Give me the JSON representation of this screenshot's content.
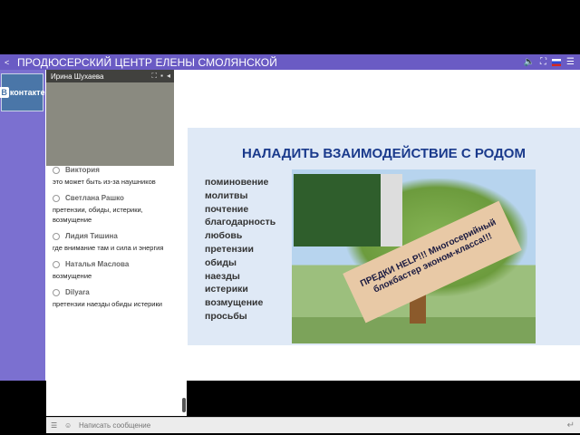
{
  "topbar": {
    "title": "ПРОДЮСЕРСКИЙ ЦЕНТР ЕЛЕНЫ СМОЛЯНСКОЙ",
    "icons": [
      "share-icon",
      "volume-icon",
      "fullscreen-icon",
      "flag-ru",
      "menu-icon"
    ]
  },
  "vk": {
    "label": "контакте",
    "b_label": "В"
  },
  "webcam": {
    "name": "Ирина Шухаева"
  },
  "chat": {
    "messages": [
      {
        "name": "Виктория",
        "text": "это может быть из-за наушников"
      },
      {
        "name": "Светлана Рашко",
        "text": "претензии, обиды, истерики, возмущение"
      },
      {
        "name": "Лидия Тишина",
        "text": "где внимание там и сила и энергия"
      },
      {
        "name": "Наталья Маслова",
        "text": "возмущение"
      },
      {
        "name": "Dilyara",
        "text": "претензии наезды обиды истерики"
      }
    ]
  },
  "slide": {
    "title": "НАЛАДИТЬ ВЗАИМОДЕЙСТВИЕ С РОДОМ",
    "items": [
      "поминовение",
      "молитвы",
      "почтение",
      "благодарность",
      "любовь",
      "претензии",
      "обиды",
      "наезды",
      "истерики",
      "возмущение",
      "просьбы"
    ],
    "banner": "ПРЕДКИ HELP!!! Многосерийный блокбастер эконом-класса!!!"
  },
  "composer": {
    "placeholder": "Написать сообщение"
  }
}
